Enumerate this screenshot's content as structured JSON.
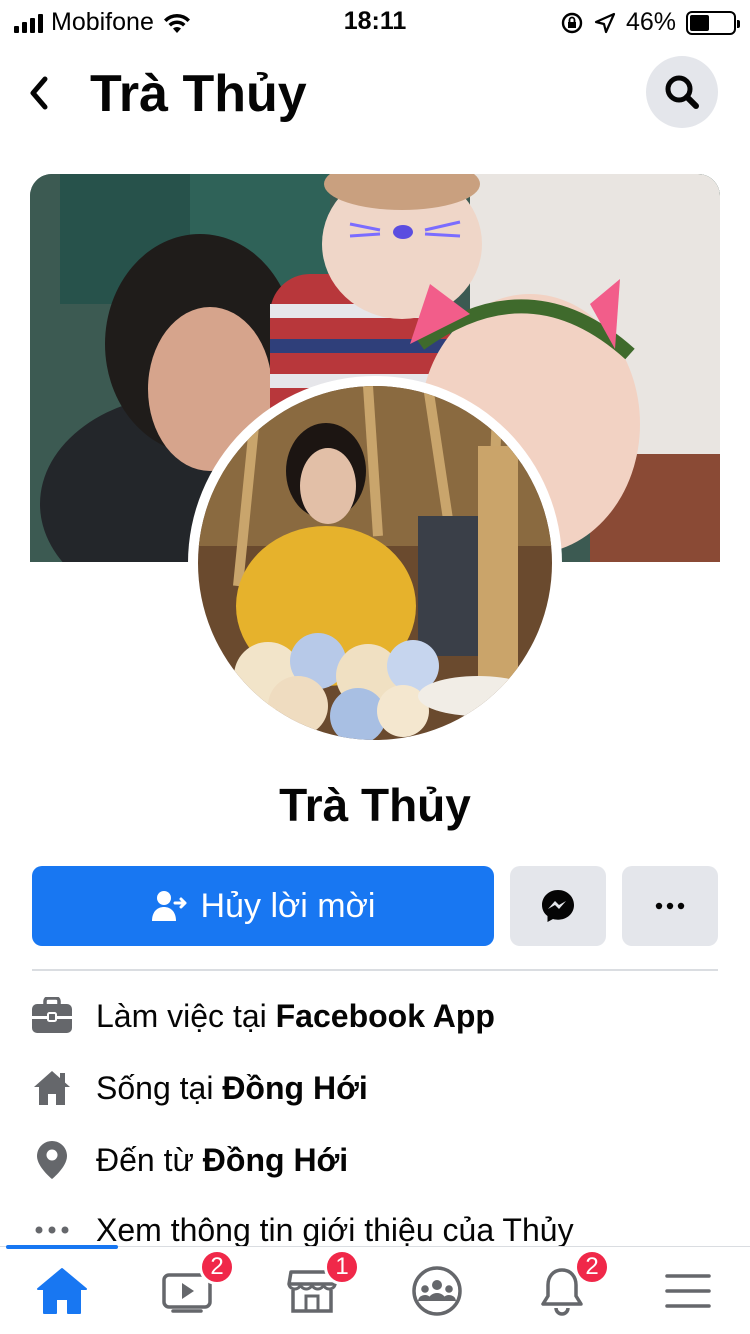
{
  "status_bar": {
    "carrier": "Mobifone",
    "time": "18:11",
    "battery_pct": "46%",
    "battery_level": 0.46
  },
  "header": {
    "title": "Trà Thủy"
  },
  "profile": {
    "name": "Trà Thủy"
  },
  "actions": {
    "primary_label": "Hủy lời mời"
  },
  "info": {
    "work": {
      "prefix": "Làm việc tại ",
      "value": "Facebook App"
    },
    "lives": {
      "prefix": "Sống tại ",
      "value": "Đồng Hới"
    },
    "from": {
      "prefix": "Đến từ ",
      "value": "Đồng Hới"
    },
    "more": "Xem thông tin giới thiệu của Thủy"
  },
  "tabs": {
    "watch_badge": "2",
    "marketplace_badge": "1",
    "notifications_badge": "2"
  },
  "colors": {
    "accent": "#1877f2",
    "badge": "#f02849",
    "button_gray": "#e4e6eb"
  },
  "icons": [
    "signal-icon",
    "wifi-icon",
    "lock-rotation-icon",
    "location-arrow-icon",
    "battery-icon",
    "back-icon",
    "search-icon",
    "add-friend-icon",
    "messenger-icon",
    "more-icon",
    "briefcase-icon",
    "home-icon",
    "location-pin-icon",
    "ellipsis-icon",
    "watch-icon",
    "marketplace-icon",
    "groups-icon",
    "bell-icon",
    "menu-icon"
  ]
}
